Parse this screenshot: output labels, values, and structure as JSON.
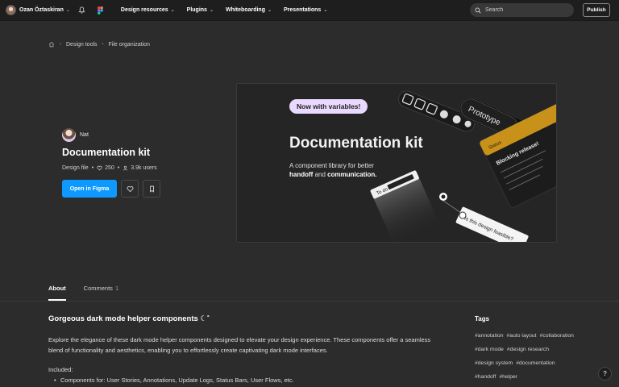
{
  "topbar": {
    "user_name": "Ozan Öztaskiran",
    "nav": [
      "Design resources",
      "Plugins",
      "Whiteboarding",
      "Presentations"
    ],
    "search_placeholder": "Search",
    "publish_label": "Publish"
  },
  "breadcrumb": {
    "items": [
      "Design tools",
      "File organization"
    ]
  },
  "file": {
    "author": "Nat",
    "title": "Documentation kit",
    "type": "Design file",
    "likes": "250",
    "users": "3.9k users",
    "open_label": "Open in Figma"
  },
  "preview": {
    "pill": "Now with variables!",
    "title": "Documentation kit",
    "subtitle_plain": "A component library for better",
    "subtitle_bold_1": "handoff",
    "subtitle_and": "and",
    "subtitle_bold_2": "communication.",
    "prototype_label": "Prototype",
    "blocking_label": "Blocking release!",
    "design_label": "Is this design feasible?",
    "todo_label": "To do"
  },
  "tabs": [
    {
      "label": "About",
      "active": true
    },
    {
      "label": "Comments",
      "count": "1",
      "active": false
    }
  ],
  "about": {
    "heading": "Gorgeous dark mode helper components ☾˚",
    "body": "Explore the elegance of these dark mode helper components designed to elevate your design experience. These components offer a seamless blend of functionality and aesthetics, enabling you to effortlessly create captivating dark mode interfaces.",
    "included": "Included:",
    "bullet_1": "Components for: User Stories, Annotations, Update Logs, Status Bars, User Flows, etc."
  },
  "tags": {
    "title": "Tags",
    "items": [
      "#annotation",
      "#auto layout",
      "#collaboration",
      "#dark mode",
      "#design research",
      "#design system",
      "#documentation",
      "#handoff",
      "#helper"
    ]
  },
  "help_label": "?",
  "colors": {
    "accent": "#0d99ff",
    "background": "#2c2c2c",
    "topbar": "#1e1e1e",
    "pill": "#e9d9ff",
    "highlight": "#c8921a"
  }
}
